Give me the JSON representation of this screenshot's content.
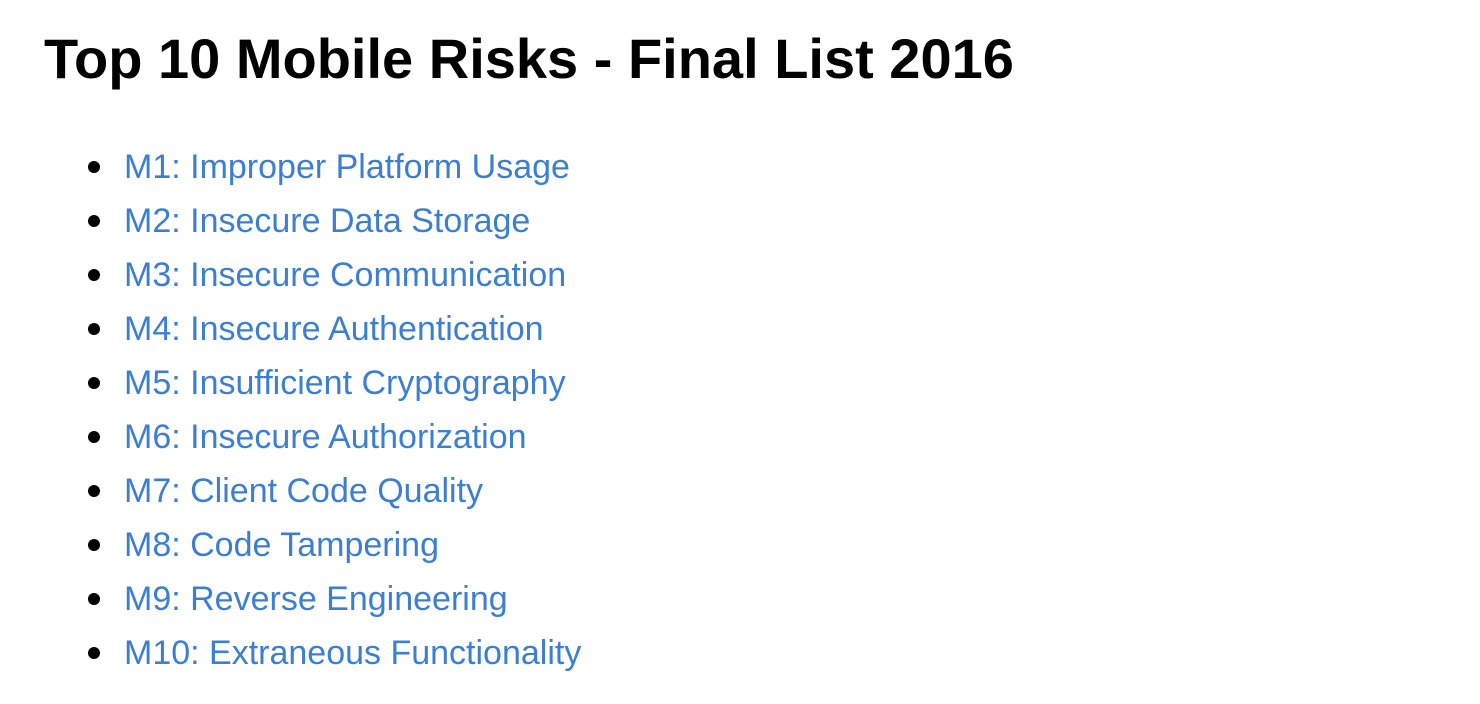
{
  "page": {
    "title": "Top 10 Mobile Risks - Final List 2016"
  },
  "colors": {
    "link": "#3c7fd0",
    "text": "#000000",
    "background": "#ffffff"
  },
  "risks": [
    {
      "label": "M1: Improper Platform Usage"
    },
    {
      "label": "M2: Insecure Data Storage"
    },
    {
      "label": "M3: Insecure Communication"
    },
    {
      "label": "M4: Insecure Authentication"
    },
    {
      "label": "M5: Insufficient Cryptography"
    },
    {
      "label": "M6: Insecure Authorization"
    },
    {
      "label": "M7: Client Code Quality"
    },
    {
      "label": "M8: Code Tampering"
    },
    {
      "label": "M9: Reverse Engineering"
    },
    {
      "label": "M10: Extraneous Functionality"
    }
  ]
}
